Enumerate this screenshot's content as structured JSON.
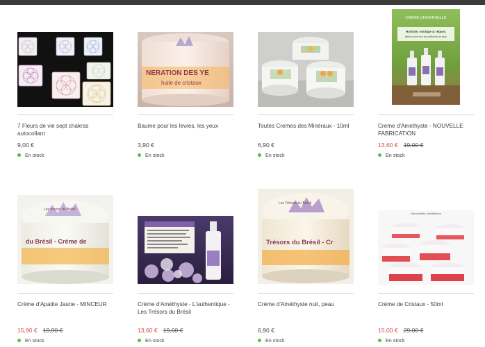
{
  "products": [
    {
      "title": "7 Fleurs de vie sept chakras autocollant",
      "price": "9,00 €",
      "old_price": "",
      "on_sale": false,
      "stock": "En stock"
    },
    {
      "title": "Baume pour les levres, les yeux",
      "price": "3,90 €",
      "old_price": "",
      "on_sale": false,
      "stock": "En stock",
      "label_text": "NERATION DES YE",
      "label_text2": "huile de cristaux"
    },
    {
      "title": "Toutes Cremes des Minéraux - 10ml",
      "price": "6,90 €",
      "old_price": "",
      "on_sale": false,
      "stock": "En stock"
    },
    {
      "title": "Creme d'Amethyste - NOUVELLE FABRICATION",
      "price": "13,60 €",
      "old_price": "19,00 €",
      "on_sale": true,
      "stock": "En stock",
      "label_text": "CRÈME UNIVERSELLE",
      "label_text2": "Hydrate, soulage & répare,",
      "label_text3": "idéale contre tous les problèmes de peau"
    },
    {
      "title": "Crème d'Apatite Jaune - MINCEUR",
      "price": "15,90 €",
      "old_price": "19,90 €",
      "on_sale": true,
      "stock": "En stock",
      "label_text": "Les trésors du Brésil",
      "label_text2": "du Brésil - Crème de"
    },
    {
      "title": "Crème d'Améthyste - L'authentique - Les Trésors du Brésil",
      "price": "13,60 €",
      "old_price": "19,00 €",
      "on_sale": true,
      "stock": "En stock"
    },
    {
      "title": "Crème d'Améthyste nuit, peau",
      "price": "6,90 €",
      "old_price": "",
      "on_sale": false,
      "stock": "En stock",
      "label_text": "Les Trésors du Brésil",
      "label_text2": "Trésors du Brésil - Cr"
    },
    {
      "title": "Crème de Cristaux - 50ml",
      "price": "15,00 €",
      "old_price": "29,00 €",
      "on_sale": true,
      "stock": "En stock",
      "label_text": "Nouveautés cristalliques"
    }
  ],
  "colors": {
    "topbar": "#3b3b3b",
    "sale_price": "#d24b45",
    "in_stock_dot": "#4fbf4f",
    "separator": "#d2d2d2"
  }
}
